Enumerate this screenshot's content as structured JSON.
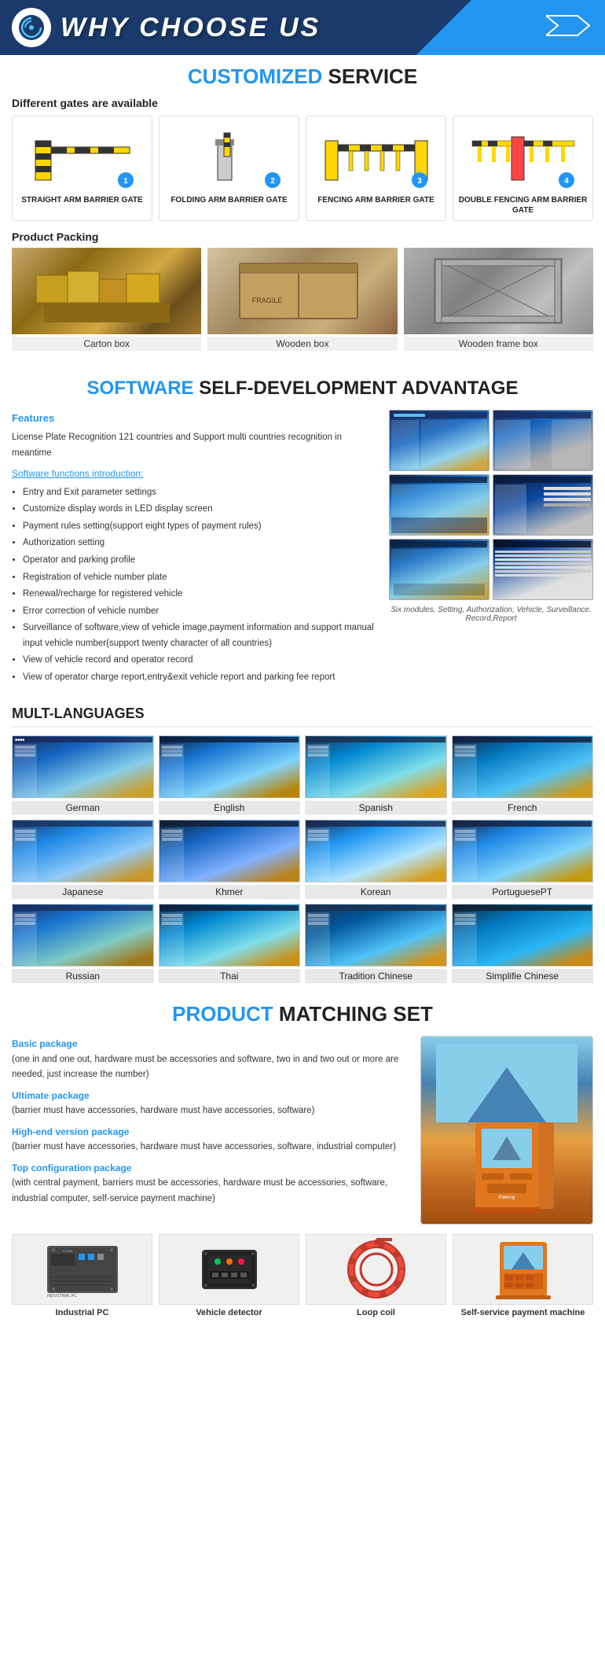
{
  "header": {
    "title1": "WHY CHOOSE US",
    "logo_alt": "company-logo"
  },
  "customized": {
    "section_title_colored": "CUSTOMIZED",
    "section_title_rest": " SERVICE",
    "subtitle": "Different gates are available",
    "gates": [
      {
        "number": "1",
        "label": "STRAIGHT ARM BARRIER GATE"
      },
      {
        "number": "2",
        "label": "FOLDING ARM BARRIER GATE"
      },
      {
        "number": "3",
        "label": "FENCING ARM BARRIER GATE"
      },
      {
        "number": "4",
        "label": "DOUBLE FENCING ARM BARRIER GATE"
      }
    ],
    "packing_title": "Product Packing",
    "packing_items": [
      {
        "label": "Carton box"
      },
      {
        "label": "Wooden box"
      },
      {
        "label": "Wooden frame box"
      }
    ]
  },
  "software": {
    "section_title_colored": "SOFTWARE",
    "section_title_rest": " SELF-DEVELOPMENT ADVANTAGE",
    "features_label": "Features",
    "features_text": "License Plate Recognition 121 countries and Support multi countries recognition in meantime",
    "intro_label": "Software functions introduction:",
    "functions": [
      "Entry and Exit parameter settings",
      "Customize display words in LED display screen",
      "Payment rules setting(support eight types of payment rules)",
      "Authorization setting",
      "Operator and parking profile",
      "Registration of vehicle number plate",
      "Renewal/recharge for registered vehicle",
      "Error correction of vehicle number",
      "Surveillance of software,view of vehicle image,payment information and support manual input vehicle number(support twenty character of all countries)",
      "View of vehicle record and operator record",
      "View of operator charge report,entry&exit vehicle report and parking fee report"
    ],
    "screenshot_caption": "Six modules, Setting, Authorization, Vehicle, Surveillance. Record,Report"
  },
  "languages": {
    "section_title": "MULT-LANGUAGES",
    "items": [
      {
        "label": "German"
      },
      {
        "label": "English"
      },
      {
        "label": "Spanish"
      },
      {
        "label": "French"
      },
      {
        "label": "Japanese"
      },
      {
        "label": "Khmer"
      },
      {
        "label": "Korean"
      },
      {
        "label": "PortuguesePT"
      },
      {
        "label": "Russian"
      },
      {
        "label": "Thai"
      },
      {
        "label": "Tradition Chinese"
      },
      {
        "label": "Simplifie Chinese"
      }
    ]
  },
  "product": {
    "section_title_colored": "PRODUCT",
    "section_title_rest": " MATCHING SET",
    "packages": [
      {
        "title": "Basic package",
        "desc": "(one in and one out, hardware must be accessories and software, two in and two out or more are needed, just increase the number)"
      },
      {
        "title": "Ultimate package",
        "desc": "(barrier must have accessories, hardware must have accessories, software)"
      },
      {
        "title": "High-end version package",
        "desc": "(barrier must have accessories, hardware must have accessories, software, industrial computer)"
      },
      {
        "title": "Top configuration package",
        "desc": "(with central payment, barriers must be accessories, hardware must be accessories, software, industrial computer, self-service payment machine)"
      }
    ],
    "hardware": [
      {
        "label": "Industrial PC"
      },
      {
        "label": "Vehicle detector"
      },
      {
        "label": "Loop coil"
      },
      {
        "label": "Self-service payment machine"
      }
    ]
  }
}
